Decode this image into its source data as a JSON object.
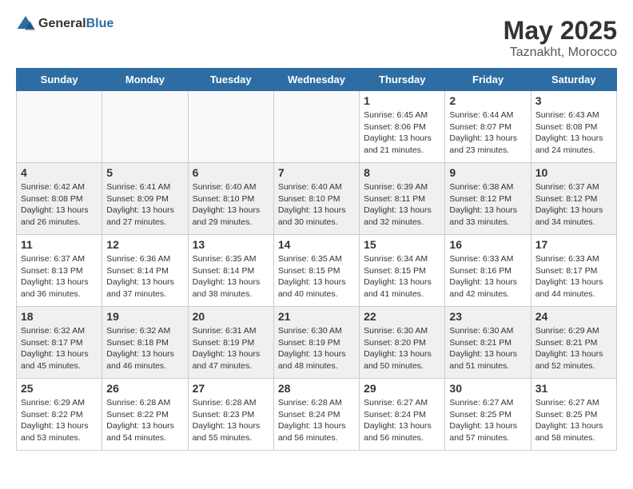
{
  "logo": {
    "text_general": "General",
    "text_blue": "Blue"
  },
  "title": "May 2025",
  "subtitle": "Taznakht, Morocco",
  "days_of_week": [
    "Sunday",
    "Monday",
    "Tuesday",
    "Wednesday",
    "Thursday",
    "Friday",
    "Saturday"
  ],
  "weeks": [
    [
      {
        "day": "",
        "content": ""
      },
      {
        "day": "",
        "content": ""
      },
      {
        "day": "",
        "content": ""
      },
      {
        "day": "",
        "content": ""
      },
      {
        "day": "1",
        "content": "Sunrise: 6:45 AM\nSunset: 8:06 PM\nDaylight: 13 hours and 21 minutes."
      },
      {
        "day": "2",
        "content": "Sunrise: 6:44 AM\nSunset: 8:07 PM\nDaylight: 13 hours and 23 minutes."
      },
      {
        "day": "3",
        "content": "Sunrise: 6:43 AM\nSunset: 8:08 PM\nDaylight: 13 hours and 24 minutes."
      }
    ],
    [
      {
        "day": "4",
        "content": "Sunrise: 6:42 AM\nSunset: 8:08 PM\nDaylight: 13 hours and 26 minutes."
      },
      {
        "day": "5",
        "content": "Sunrise: 6:41 AM\nSunset: 8:09 PM\nDaylight: 13 hours and 27 minutes."
      },
      {
        "day": "6",
        "content": "Sunrise: 6:40 AM\nSunset: 8:10 PM\nDaylight: 13 hours and 29 minutes."
      },
      {
        "day": "7",
        "content": "Sunrise: 6:40 AM\nSunset: 8:10 PM\nDaylight: 13 hours and 30 minutes."
      },
      {
        "day": "8",
        "content": "Sunrise: 6:39 AM\nSunset: 8:11 PM\nDaylight: 13 hours and 32 minutes."
      },
      {
        "day": "9",
        "content": "Sunrise: 6:38 AM\nSunset: 8:12 PM\nDaylight: 13 hours and 33 minutes."
      },
      {
        "day": "10",
        "content": "Sunrise: 6:37 AM\nSunset: 8:12 PM\nDaylight: 13 hours and 34 minutes."
      }
    ],
    [
      {
        "day": "11",
        "content": "Sunrise: 6:37 AM\nSunset: 8:13 PM\nDaylight: 13 hours and 36 minutes."
      },
      {
        "day": "12",
        "content": "Sunrise: 6:36 AM\nSunset: 8:14 PM\nDaylight: 13 hours and 37 minutes."
      },
      {
        "day": "13",
        "content": "Sunrise: 6:35 AM\nSunset: 8:14 PM\nDaylight: 13 hours and 38 minutes."
      },
      {
        "day": "14",
        "content": "Sunrise: 6:35 AM\nSunset: 8:15 PM\nDaylight: 13 hours and 40 minutes."
      },
      {
        "day": "15",
        "content": "Sunrise: 6:34 AM\nSunset: 8:15 PM\nDaylight: 13 hours and 41 minutes."
      },
      {
        "day": "16",
        "content": "Sunrise: 6:33 AM\nSunset: 8:16 PM\nDaylight: 13 hours and 42 minutes."
      },
      {
        "day": "17",
        "content": "Sunrise: 6:33 AM\nSunset: 8:17 PM\nDaylight: 13 hours and 44 minutes."
      }
    ],
    [
      {
        "day": "18",
        "content": "Sunrise: 6:32 AM\nSunset: 8:17 PM\nDaylight: 13 hours and 45 minutes."
      },
      {
        "day": "19",
        "content": "Sunrise: 6:32 AM\nSunset: 8:18 PM\nDaylight: 13 hours and 46 minutes."
      },
      {
        "day": "20",
        "content": "Sunrise: 6:31 AM\nSunset: 8:19 PM\nDaylight: 13 hours and 47 minutes."
      },
      {
        "day": "21",
        "content": "Sunrise: 6:30 AM\nSunset: 8:19 PM\nDaylight: 13 hours and 48 minutes."
      },
      {
        "day": "22",
        "content": "Sunrise: 6:30 AM\nSunset: 8:20 PM\nDaylight: 13 hours and 50 minutes."
      },
      {
        "day": "23",
        "content": "Sunrise: 6:30 AM\nSunset: 8:21 PM\nDaylight: 13 hours and 51 minutes."
      },
      {
        "day": "24",
        "content": "Sunrise: 6:29 AM\nSunset: 8:21 PM\nDaylight: 13 hours and 52 minutes."
      }
    ],
    [
      {
        "day": "25",
        "content": "Sunrise: 6:29 AM\nSunset: 8:22 PM\nDaylight: 13 hours and 53 minutes."
      },
      {
        "day": "26",
        "content": "Sunrise: 6:28 AM\nSunset: 8:22 PM\nDaylight: 13 hours and 54 minutes."
      },
      {
        "day": "27",
        "content": "Sunrise: 6:28 AM\nSunset: 8:23 PM\nDaylight: 13 hours and 55 minutes."
      },
      {
        "day": "28",
        "content": "Sunrise: 6:28 AM\nSunset: 8:24 PM\nDaylight: 13 hours and 56 minutes."
      },
      {
        "day": "29",
        "content": "Sunrise: 6:27 AM\nSunset: 8:24 PM\nDaylight: 13 hours and 56 minutes."
      },
      {
        "day": "30",
        "content": "Sunrise: 6:27 AM\nSunset: 8:25 PM\nDaylight: 13 hours and 57 minutes."
      },
      {
        "day": "31",
        "content": "Sunrise: 6:27 AM\nSunset: 8:25 PM\nDaylight: 13 hours and 58 minutes."
      }
    ]
  ]
}
